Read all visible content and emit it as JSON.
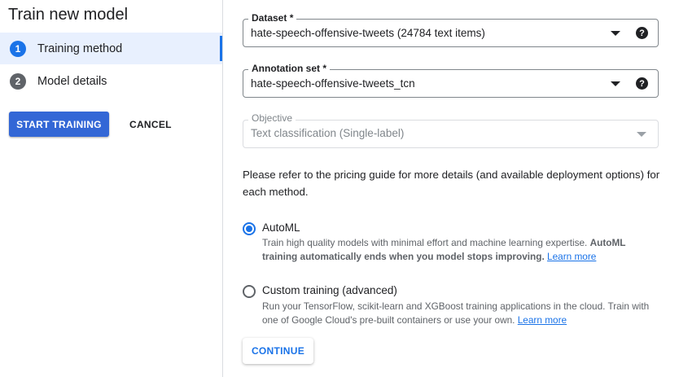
{
  "sidebar": {
    "title": "Train new model",
    "steps": [
      {
        "number": "1",
        "label": "Training method",
        "active": true
      },
      {
        "number": "2",
        "label": "Model details",
        "active": false
      }
    ],
    "start_button": "START TRAINING",
    "cancel_button": "CANCEL"
  },
  "form": {
    "dataset": {
      "label": "Dataset *",
      "value": "hate-speech-offensive-tweets (24784 text items)",
      "icon": "help-icon"
    },
    "annotation": {
      "label": "Annotation set *",
      "value": "hate-speech-offensive-tweets_tcn",
      "icon": "help-icon"
    },
    "objective": {
      "label": "Objective",
      "value": "Text classification (Single-label)"
    },
    "info_text": "Please refer to the pricing guide for more details (and available deployment options) for each method.",
    "options": [
      {
        "title": "AutoML",
        "checked": true,
        "desc_plain": "Train high quality models with minimal effort and machine learning expertise. ",
        "desc_bold": "AutoML training automatically ends when you model stops improving.",
        "link": "Learn more"
      },
      {
        "title": "Custom training (advanced)",
        "checked": false,
        "desc_plain": "Run your TensorFlow, scikit-learn and XGBoost training applications in the cloud. Train with one of Google Cloud's pre-built containers or use your own.",
        "link": "Learn more"
      }
    ],
    "continue_button": "CONTINUE",
    "help_glyph": "?"
  },
  "colors": {
    "accent": "#1a73e8",
    "primary_button": "#3367d6",
    "active_step_bg": "#e8f0fe"
  }
}
